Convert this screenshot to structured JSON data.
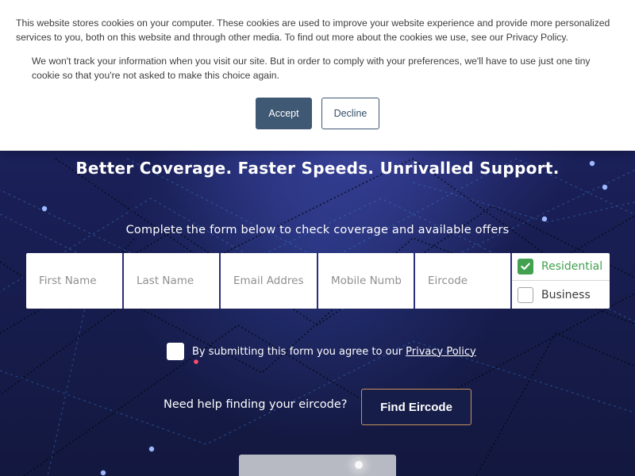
{
  "cookie_banner": {
    "main_text": "This website stores cookies on your computer. These cookies are used to improve your website experience and provide more personalized services to you, both on this website and through other media. To find out more about the cookies we use, see our Privacy Policy.",
    "secondary_text": "We won't track your information when you visit our site. But in order to comply with your preferences, we'll have to use just one tiny cookie so that you're not asked to make this choice again.",
    "accept_label": "Accept",
    "decline_label": "Decline"
  },
  "hero": {
    "title": "Better Coverage. Faster Speeds. Unrivalled Support."
  },
  "form": {
    "intro": "Complete the form below to check coverage and available offers",
    "fields": [
      {
        "placeholder": "First Name",
        "value": ""
      },
      {
        "placeholder": "Last Name",
        "value": ""
      },
      {
        "placeholder": "Email Addres",
        "value": ""
      },
      {
        "placeholder": "Mobile Numb",
        "value": ""
      },
      {
        "placeholder": "Eircode",
        "value": ""
      }
    ],
    "customer_type": {
      "residential_label": "Residential",
      "business_label": "Business",
      "residential_selected": true,
      "business_selected": false
    },
    "agreement": {
      "text": "By submitting this form you agree to our",
      "link_text": "Privacy Policy",
      "checked": false
    },
    "eircode_help": "Need help finding your eircode?",
    "find_eircode_label": "Find Eircode"
  },
  "colors": {
    "accept_button": "#3f5873",
    "residential_selected": "#42a14f",
    "find_button_border": "#c9925d",
    "background": "#1b2160"
  },
  "icons": {
    "residential_check": "check-icon"
  }
}
